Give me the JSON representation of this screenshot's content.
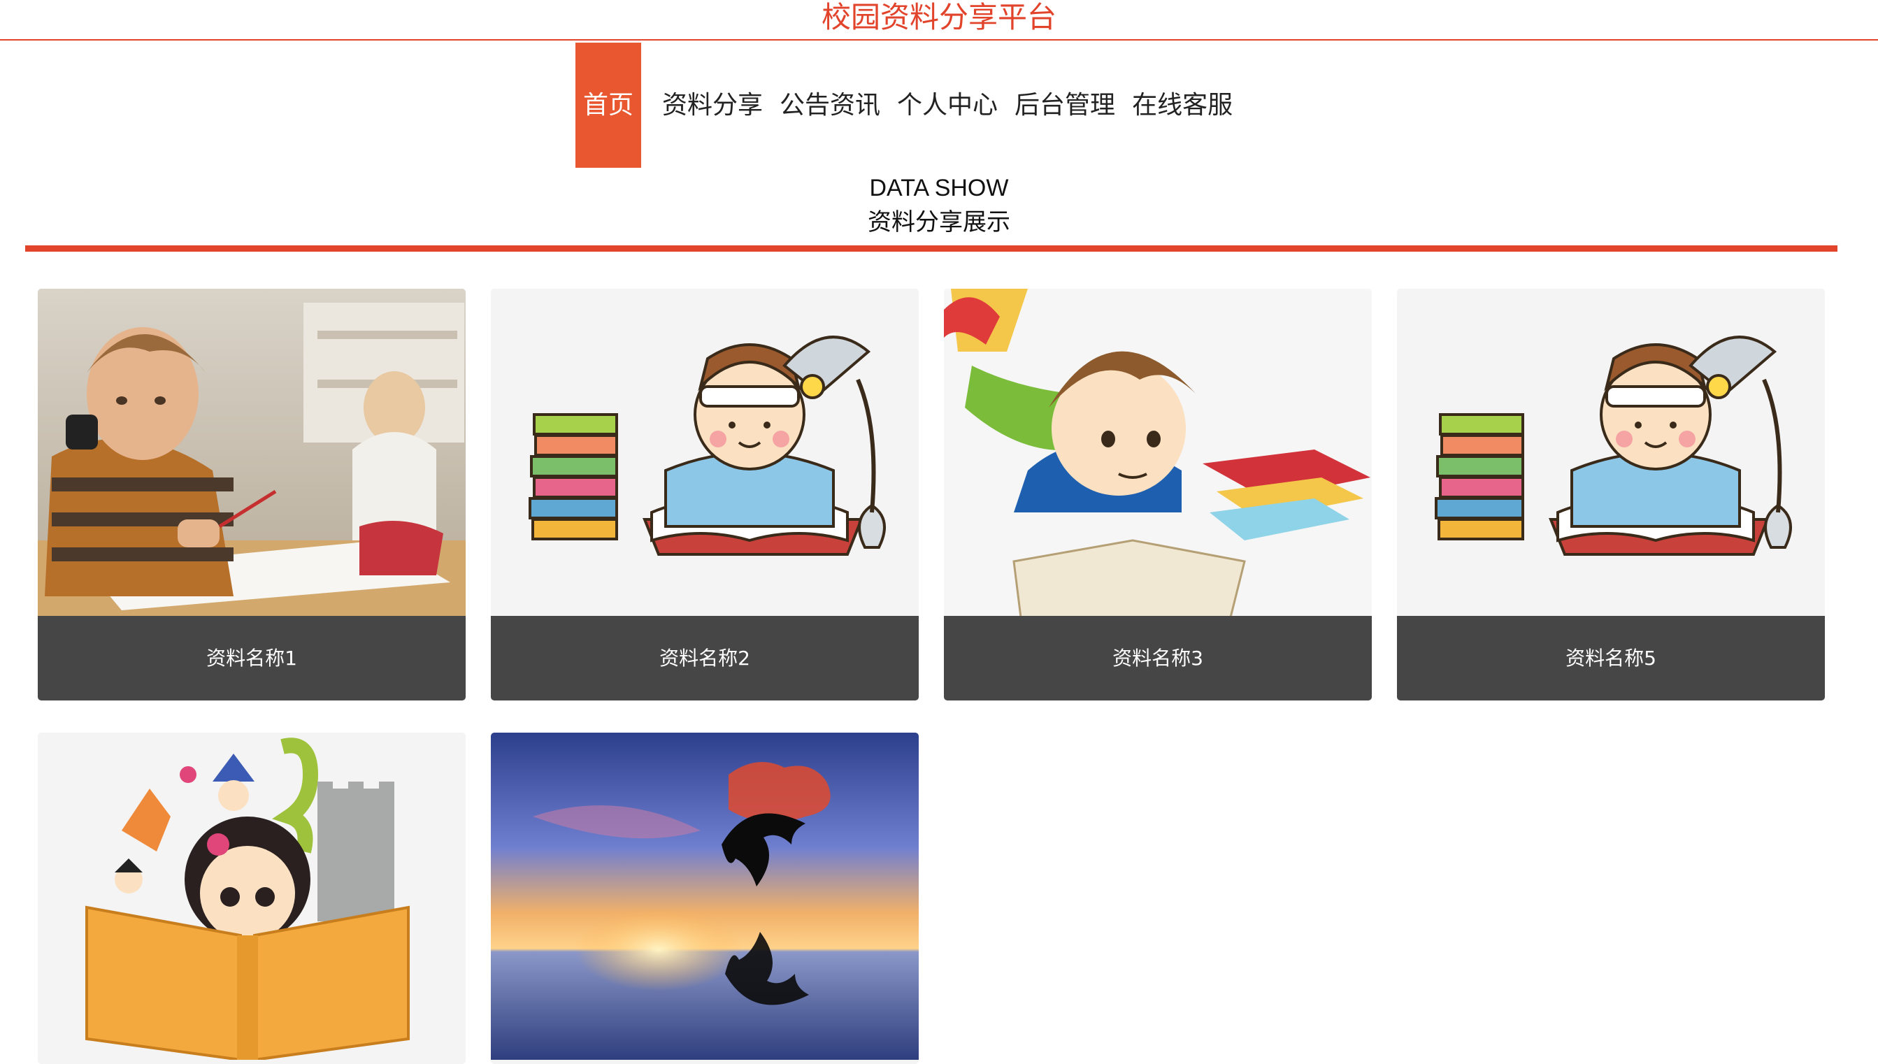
{
  "header": {
    "title": "校园资料分享平台"
  },
  "nav": {
    "items": [
      {
        "label": "首页",
        "active": true
      },
      {
        "label": "资料分享",
        "active": false
      },
      {
        "label": "公告资讯",
        "active": false
      },
      {
        "label": "个人中心",
        "active": false
      },
      {
        "label": "后台管理",
        "active": false
      },
      {
        "label": "在线客服",
        "active": false
      }
    ]
  },
  "section": {
    "title_en": "DATA SHOW",
    "title_cn": "资料分享展示"
  },
  "cards": [
    {
      "name": "资料名称1",
      "image": "boy-in-classroom-photo"
    },
    {
      "name": "资料名称2",
      "image": "cartoon-boy-reading-with-lamp"
    },
    {
      "name": "资料名称3",
      "image": "cartoon-boy-lying-reading"
    },
    {
      "name": "资料名称5",
      "image": "cartoon-boy-reading-with-lamp"
    },
    {
      "name": "",
      "image": "cartoon-girl-reading-storybook"
    },
    {
      "name": "",
      "image": "dolphin-sunset-photo"
    }
  ],
  "colors": {
    "accent": "#e2432b",
    "nav_active": "#e85730",
    "caption_bg": "#464646"
  }
}
